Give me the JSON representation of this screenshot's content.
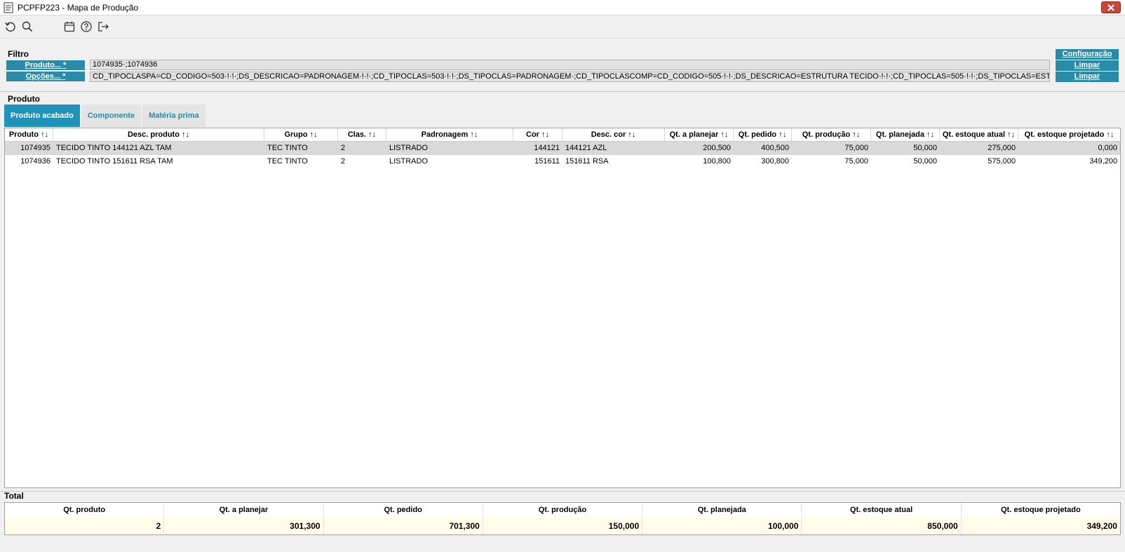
{
  "window": {
    "title": "PCPFP223 - Mapa de Produção"
  },
  "filter": {
    "section_label": "Filtro",
    "produto_label": "Produto... *",
    "opcoes_label": "Opções... *",
    "produto_value": "1074935·;1074936",
    "opcoes_value": "CD_TIPOCLASPA=CD_CODIGO=503·!·!·;DS_DESCRICAO=PADRONAGEM·!·!·;CD_TIPOCLAS=503·!·!·;DS_TIPOCLAS=PADRONAGEM·;CD_TIPOCLASCOMP=CD_CODIGO=505·!·!·;DS_DESCRICAO=ESTRUTURA TECIDO·!·!·;CD_TIPOCLAS=505·!·!·;DS_TIPOCLAS=ESTRUTURA TECIDO·;CD_",
    "configuracao_label": "Configuração",
    "limpar_label": "Limpar"
  },
  "produto_section": {
    "label": "Produto",
    "tabs": [
      "Produto acabado",
      "Componente",
      "Matéria prima"
    ]
  },
  "grid": {
    "columns": [
      "Produto ↑↓",
      "Desc. produto ↑↓",
      "Grupo ↑↓",
      "Clas. ↑↓",
      "Padronagem ↑↓",
      "Cor ↑↓",
      "Desc. cor ↑↓",
      "Qt. a planejar ↑↓",
      "Qt. pedido ↑↓",
      "Qt. produção ↑↓",
      "Qt. planejada ↑↓",
      "Qt. estoque atual ↑↓",
      "Qt. estoque projetado ↑↓"
    ],
    "rows": [
      [
        "1074935",
        "TECIDO TINTO 144121 AZL TAM",
        "TEC TINTO",
        "2",
        "LISTRADO",
        "144121",
        "144121 AZL",
        "200,500",
        "400,500",
        "75,000",
        "50,000",
        "275,000",
        "0,000"
      ],
      [
        "1074936",
        "TECIDO TINTO 151611 RSA TAM",
        "TEC TINTO",
        "2",
        "LISTRADO",
        "151611",
        "151611 RSA",
        "100,800",
        "300,800",
        "75,000",
        "50,000",
        "575,000",
        "349,200"
      ]
    ]
  },
  "totals": {
    "label": "Total",
    "headers": [
      "Qt. produto",
      "Qt. a planejar",
      "Qt. pedido",
      "Qt. produção",
      "Qt. planejada",
      "Qt. estoque atual",
      "Qt. estoque projetado"
    ],
    "values": [
      "2",
      "301,300",
      "701,300",
      "150,000",
      "100,000",
      "850,000",
      "349,200"
    ]
  },
  "toolbar": {
    "icons": [
      "refresh-icon",
      "search-icon",
      "calendar-icon",
      "help-icon",
      "exit-icon"
    ]
  },
  "colors": {
    "accent": "#2a8ba8",
    "active_tab": "#1f93b9",
    "total_row_bg": "#fefee8"
  }
}
